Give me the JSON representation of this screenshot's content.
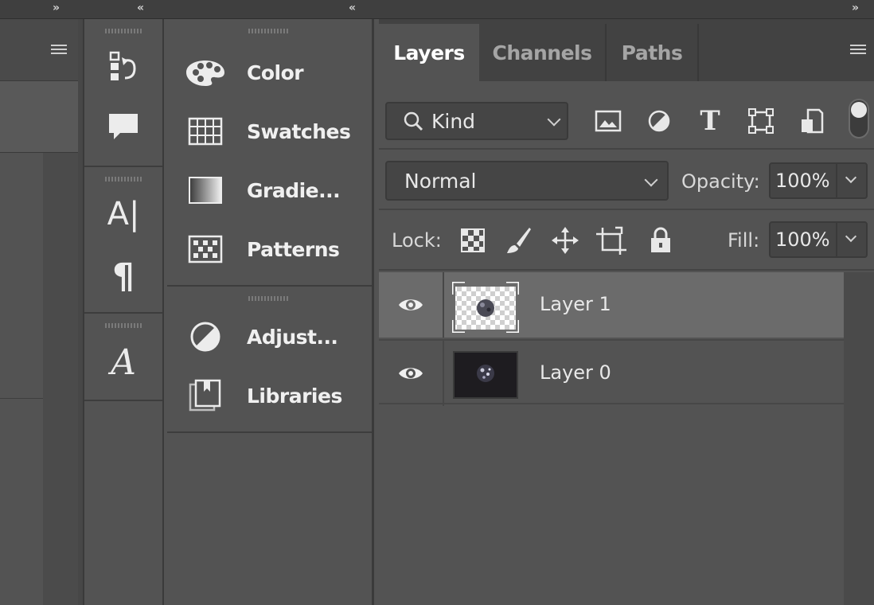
{
  "window": {
    "collapse_left": "»",
    "collapse_mid1": "«",
    "collapse_mid2": "«",
    "collapse_right": "»"
  },
  "strip_icons": [
    {
      "icon": "history-icon"
    },
    {
      "icon": "comment-icon"
    },
    {
      "icon": "character-icon",
      "glyph": "A|"
    },
    {
      "icon": "paragraph-icon",
      "glyph": "¶"
    },
    {
      "icon": "glyphs-icon",
      "glyph": "A"
    }
  ],
  "panel_list": {
    "items": [
      {
        "label": "Color",
        "icon": "palette-icon"
      },
      {
        "label": "Swatches",
        "icon": "swatches-icon"
      },
      {
        "label": "Gradie...",
        "icon": "gradient-icon"
      },
      {
        "label": "Patterns",
        "icon": "patterns-icon"
      },
      {
        "label": "Adjust...",
        "icon": "adjustments-icon"
      },
      {
        "label": "Libraries",
        "icon": "libraries-icon"
      }
    ]
  },
  "layers_panel": {
    "tabs": [
      {
        "label": "Layers",
        "active": true
      },
      {
        "label": "Channels",
        "active": false
      },
      {
        "label": "Paths",
        "active": false
      }
    ],
    "filter": {
      "kind_label": "Kind"
    },
    "blend_mode": "Normal",
    "opacity_label": "Opacity:",
    "opacity_value": "100%",
    "lock_label": "Lock:",
    "fill_label": "Fill:",
    "fill_value": "100%",
    "layers": [
      {
        "name": "Layer 1",
        "visible": true,
        "selected": true
      },
      {
        "name": "Layer 0",
        "visible": true,
        "selected": false
      }
    ]
  },
  "colors": {
    "panel_bg": "#535353",
    "tab_bar_bg": "#424242",
    "selected_row": "#6b6b6b"
  }
}
